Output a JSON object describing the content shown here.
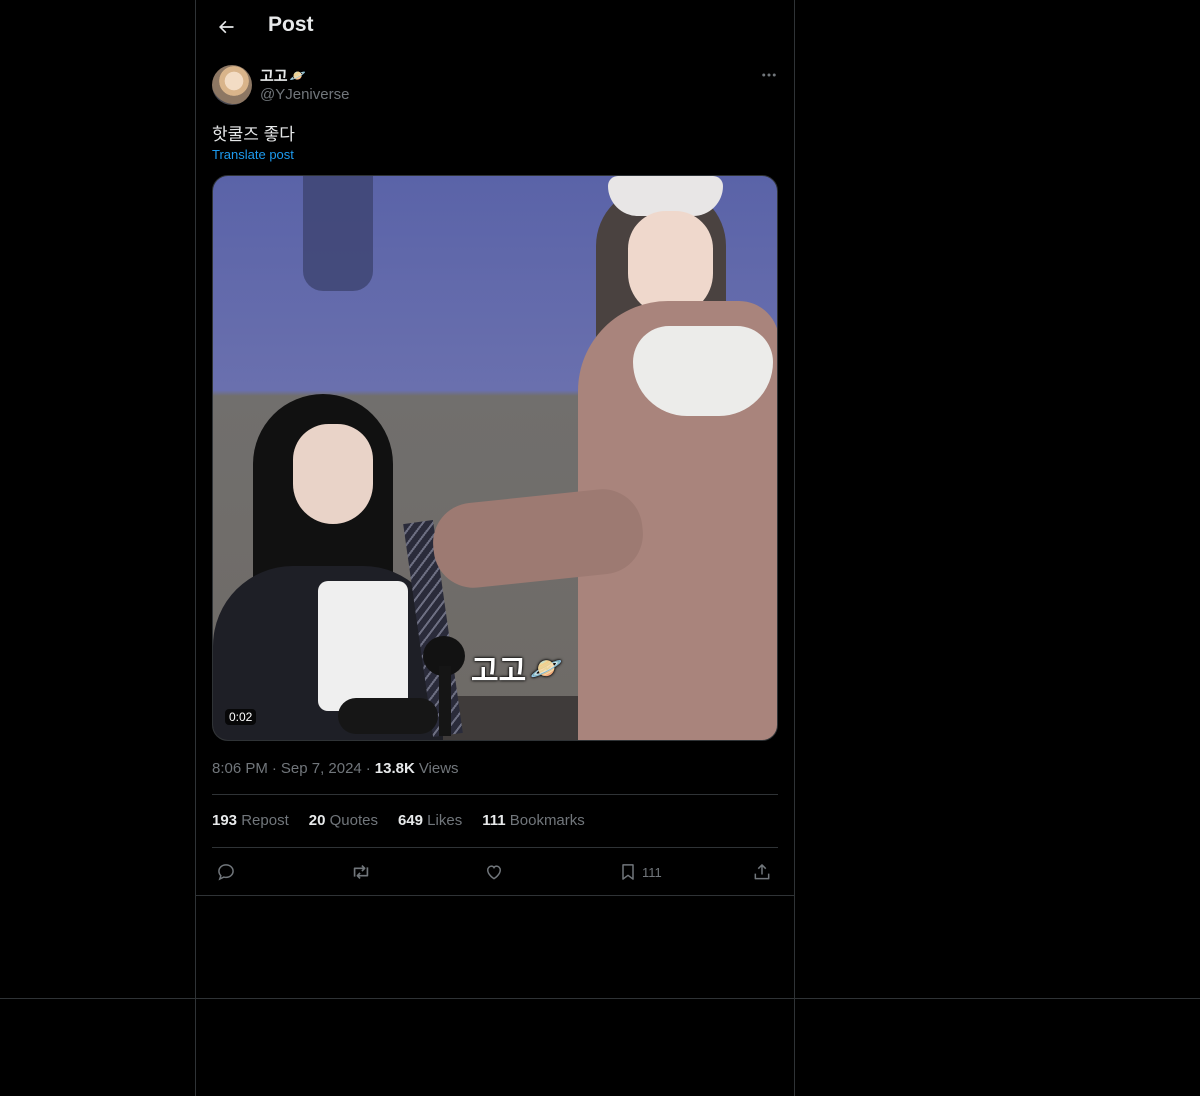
{
  "header": {
    "title": "Post"
  },
  "author": {
    "name": "고고",
    "name_emoji": "🪐",
    "handle": "@YJeniverse"
  },
  "post": {
    "text": "핫쿨즈 좋다",
    "translate_label": "Translate post"
  },
  "media": {
    "duration": "0:02",
    "overlay_text": "고고",
    "overlay_emoji": "🪐"
  },
  "meta": {
    "time": "8:06 PM",
    "dot1": "·",
    "date": "Sep 7, 2024",
    "dot2": "·",
    "views_count": "13.8K",
    "views_label": "Views"
  },
  "stats": [
    {
      "count": "193",
      "label": "Repost"
    },
    {
      "count": "20",
      "label": "Quotes"
    },
    {
      "count": "649",
      "label": "Likes"
    },
    {
      "count": "111",
      "label": "Bookmarks"
    }
  ],
  "actions": {
    "bookmark_count": "111"
  },
  "icons": {
    "back": "arrow-left-icon",
    "more": "more-horizontal-icon",
    "reply": "reply-icon",
    "repost": "repost-icon",
    "like": "heart-icon",
    "bookmark": "bookmark-icon",
    "share": "share-icon"
  },
  "colors": {
    "background": "#000000",
    "border": "#2f3336",
    "link": "#1d9bf0",
    "muted": "#71767b",
    "text": "#e7e9ea"
  }
}
